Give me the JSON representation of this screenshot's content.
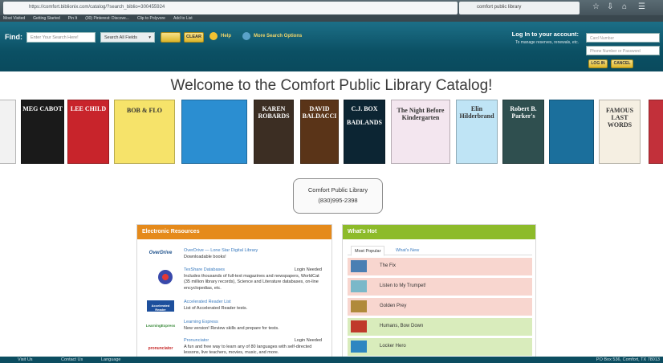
{
  "browser": {
    "url": "https://comfort.biblionix.com/catalog/?search_biblio=300455924",
    "search_value": "comfort public library",
    "bookmarks": [
      "Most Visited",
      "Getting Started",
      "Pin It",
      "(30) Pinterest: Discove...",
      "Clip to Polyvore",
      "Add to List"
    ]
  },
  "header": {
    "find_label": "Find:",
    "search_placeholder": "Enter Your Search Here!",
    "field_select": "Search All Fields",
    "clear_label": "CLEAR",
    "help_label": "Help",
    "more_options_label": "More Search Options",
    "login_title": "Log In to your account:",
    "login_subtitle": "To manage reserves, renewals, etc.",
    "card_placeholder": "Card Number",
    "password_placeholder": "Phone Number or Password",
    "login_button": "LOG IN",
    "cancel_button": "CANCEL"
  },
  "welcome": "Welcome to the Comfort Public Library Catalog!",
  "carousel": {
    "books": [
      {
        "title": "",
        "author": "",
        "color": "#f2f2f2"
      },
      {
        "title": "",
        "author": "MEG CABOT",
        "color": "#1a1a1a"
      },
      {
        "title": "",
        "author": "LEE CHILD",
        "color": "#c8242b"
      },
      {
        "title": "BOB & FLO",
        "author": "",
        "color": "#f6e36a"
      },
      {
        "title": "",
        "author": "",
        "color": "#2b8ed1"
      },
      {
        "title": "",
        "author": "KAREN ROBARDS",
        "color": "#3c2e23"
      },
      {
        "title": "",
        "author": "DAVID BALDACCI",
        "color": "#5a3418"
      },
      {
        "title": "BADLANDS",
        "author": "C.J. BOX",
        "color": "#0c2533"
      },
      {
        "title": "The Night Before Kindergarten",
        "author": "",
        "color": "#f3e6ef"
      },
      {
        "title": "",
        "author": "Elin Hilderbrand",
        "color": "#bfe4f5"
      },
      {
        "title": "",
        "author": "Robert B. Parker's",
        "color": "#2f4f4f"
      },
      {
        "title": "",
        "author": "",
        "color": "#1b6f9c"
      },
      {
        "title": "FAMOUS LAST WORDS",
        "author": "",
        "color": "#f5efe2"
      },
      {
        "title": "",
        "author": "",
        "color": "#c2303a"
      }
    ]
  },
  "contact": {
    "name": "Comfort Public Library",
    "phone": "(830)995-2398"
  },
  "electronic_resources": {
    "title": "Electronic Resources",
    "items": [
      {
        "logo": "OverDrive",
        "name": "OverDrive — Lone Star Digital Library",
        "desc": "Downloadable books!",
        "login": ""
      },
      {
        "logo": "",
        "name": "TexShare Databases",
        "desc": "Includes thousands of full-text magazines and newspapers, WorldCat (35 million library records), Science and Literature databases, on-line encyclopedias, etc.",
        "login": "Login Needed"
      },
      {
        "logo": "Accelerated Reader",
        "name": "Accelerated Reader List",
        "desc": "List of Accelerated Reader tests.",
        "login": ""
      },
      {
        "logo": "LearningExpress",
        "name": "Learning Express",
        "desc": "New version! Review skills and prepare for tests.",
        "login": ""
      },
      {
        "logo": "pronunciator",
        "name": "Pronunciator",
        "desc": "A fun and free way to learn any of 80 languages with self-directed lessons, live teachers, movies, music, and more.",
        "login": "Login Needed"
      }
    ]
  },
  "whats_hot": {
    "title": "What's Hot",
    "tabs": [
      "Most Popular",
      "What's New"
    ],
    "items": [
      {
        "title": "The Fix",
        "bg": "#f8d6cf"
      },
      {
        "title": "Listen to My Trumpet!",
        "bg": "#f8d6cf"
      },
      {
        "title": "Golden Prey",
        "bg": "#f8d6cf"
      },
      {
        "title": "Humans, Bow Down",
        "bg": "#d9ecbc"
      },
      {
        "title": "Locker Hero",
        "bg": "#d9ecbc"
      }
    ]
  },
  "footer": {
    "links": [
      "Visit Us",
      "Contact Us",
      "Language"
    ],
    "address": "PO Box 536, Comfort, TX 78013"
  },
  "colors": {
    "header": "#0b5064",
    "accent_yellow": "#dcb62a",
    "er_head": "#e58a1b",
    "hot_head": "#8dbb2a"
  }
}
